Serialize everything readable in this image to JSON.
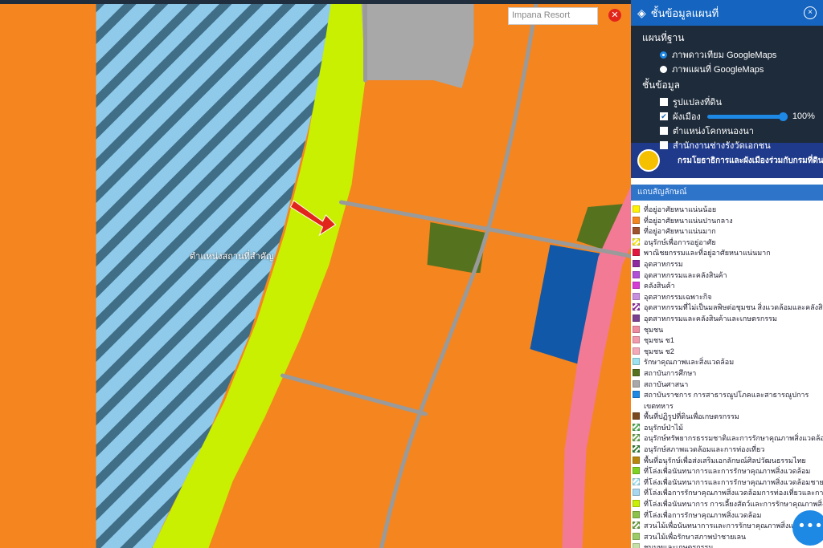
{
  "map": {
    "search_placeholder": "Impana Resort",
    "marker_label": "ตำแหน่งสถานที่สำคัญ",
    "colors": {
      "water_stripe": "#8fcaea",
      "water_stripe_dark": "#3f6e86",
      "green_strip": "#c8f000",
      "orange": "#f5851f",
      "gray": "#a8a8a8",
      "olive": "#55721f",
      "blue": "#1159a8",
      "pink": "#f27a95",
      "red": "#e3173e",
      "road": "#9a9a9a"
    }
  },
  "panel": {
    "title": "ชั้นข้อมูลแผนที่",
    "base_map_title": "แผนที่ฐาน",
    "base_maps": [
      {
        "label": "ภาพดาวเทียม GoogleMaps",
        "selected": true
      },
      {
        "label": "ภาพแผนที่ GoogleMaps",
        "selected": false
      }
    ],
    "layers_title": "ชั้นข้อมูล",
    "layers": [
      {
        "label": "รูปแปลงที่ดิน",
        "checked": false
      },
      {
        "label": "ผังเมือง",
        "checked": true,
        "opacity": "100%"
      },
      {
        "label": "ตำแหน่งโคกหนองนา",
        "checked": false
      },
      {
        "label": "สำนักงานช่างรังวัดเอกชน",
        "checked": false
      }
    ],
    "org_name": "กรมโยธาธิการและผังเมืองร่วมกับกรมที่ดิน",
    "legend_title": "แถบสัญลักษณ์",
    "legend": [
      {
        "label": "ที่อยู่อาศัยหนาแน่นน้อย",
        "color": "#fff200"
      },
      {
        "label": "ที่อยู่อาศัยหนาแน่นปานกลาง",
        "color": "#f5851f"
      },
      {
        "label": "ที่อยู่อาศัยหนาแน่นมาก",
        "color": "#a0522d"
      },
      {
        "label": "อนุรักษ์เพื่อการอยู่อาศัย",
        "color": "#f7e600",
        "hatch": true
      },
      {
        "label": "พาณิชยกรรมและที่อยู่อาศัยหนาแน่นมาก",
        "color": "#e3173e"
      },
      {
        "label": "อุตสาหกรรม",
        "color": "#8e2ba0"
      },
      {
        "label": "อุตสาหกรรมและคลังสินค้า",
        "color": "#b04fd8"
      },
      {
        "label": "คลังสินค้า",
        "color": "#d63bd8"
      },
      {
        "label": "อุตสาหกรรมเฉพาะกิจ",
        "color": "#c890e0"
      },
      {
        "label": "อุตสาหกรรมที่ไม่เป็นมลพิษต่อชุมชน สิ่งแวดล้อมและคลังสินค้า",
        "color": "#8e2ba0",
        "hatch": true
      },
      {
        "label": "อุตสาหกรรมและคลังสินค้าและเกษตรกรรม",
        "color": "#7b3f8f"
      },
      {
        "label": "ชุมชน",
        "color": "#f08ca0"
      },
      {
        "label": "ชุมชน ช1",
        "color": "#f39aab"
      },
      {
        "label": "ชุมชน ช2",
        "color": "#f5a8b8"
      },
      {
        "label": "รักษาคุณภาพและสิ่งแวดล้อม",
        "color": "#9be3f0"
      },
      {
        "label": "สถาบันการศึกษา",
        "color": "#55721f"
      },
      {
        "label": "สถาบันศาสนา",
        "color": "#a8a8a8"
      },
      {
        "label": "สถาบันราชการ การสาธารณูปโภคและสาธารณูปการ",
        "color": "#1e88e5"
      },
      {
        "label": "เขตทหาร",
        "color": ""
      },
      {
        "label": "พื้นที่ปฏิรูปที่ดินเพื่อเกษตรกรรม",
        "color": "#7a4a1f"
      },
      {
        "label": "อนุรักษ์ป่าไม้",
        "color": "#4caf50",
        "hatch": true
      },
      {
        "label": "อนุรักษ์ทรัพยากรธรรมชาติและการรักษาคุณภาพสิ่งแวดล้อม",
        "color": "#6aa84f",
        "hatch": true
      },
      {
        "label": "อนุรักษ์สภาพแวดล้อมและการท่องเที่ยว",
        "color": "#2e7d32",
        "hatch": true
      },
      {
        "label": "พื้นที่อนุรักษ์เพื่อส่งเสริมเอกลักษณ์ศิลปวัฒนธรรมไทย",
        "color": "#b8860b"
      },
      {
        "label": "ที่โล่งเพื่อนันทนาการและการรักษาคุณภาพสิ่งแวดล้อม",
        "color": "#7ed321"
      },
      {
        "label": "ที่โล่งเพื่อนันทนาการและการรักษาคุณภาพสิ่งแวดล้อมชายฝั่ง",
        "color": "#9be3f0",
        "hatch": true
      },
      {
        "label": "ที่โล่งเพื่อการรักษาคุณภาพสิ่งแวดล้อมการท่องเที่ยวและการป",
        "color": "#a8d8f0"
      },
      {
        "label": "ที่โล่งเพื่อนันทนาการ การเลี้ยงสัตว์และการรักษาคุณภาพสิ่งแว",
        "color": "#c8f000"
      },
      {
        "label": "ที่โล่งเพื่อการรักษาคุณภาพสิ่งแวดล้อม",
        "color": "#8bc34a"
      },
      {
        "label": "สวนไม้เพื่อนันทนาการและการรักษาคุณภาพสิ่งแวด",
        "color": "#689f38",
        "hatch": true
      },
      {
        "label": "สวนไม้เพื่อรักษาสภาพป่าชายเลน",
        "color": "#9ccc65"
      },
      {
        "label": "ชนบทและเกษตรกรรม",
        "color": "#c5e1a5"
      }
    ]
  }
}
